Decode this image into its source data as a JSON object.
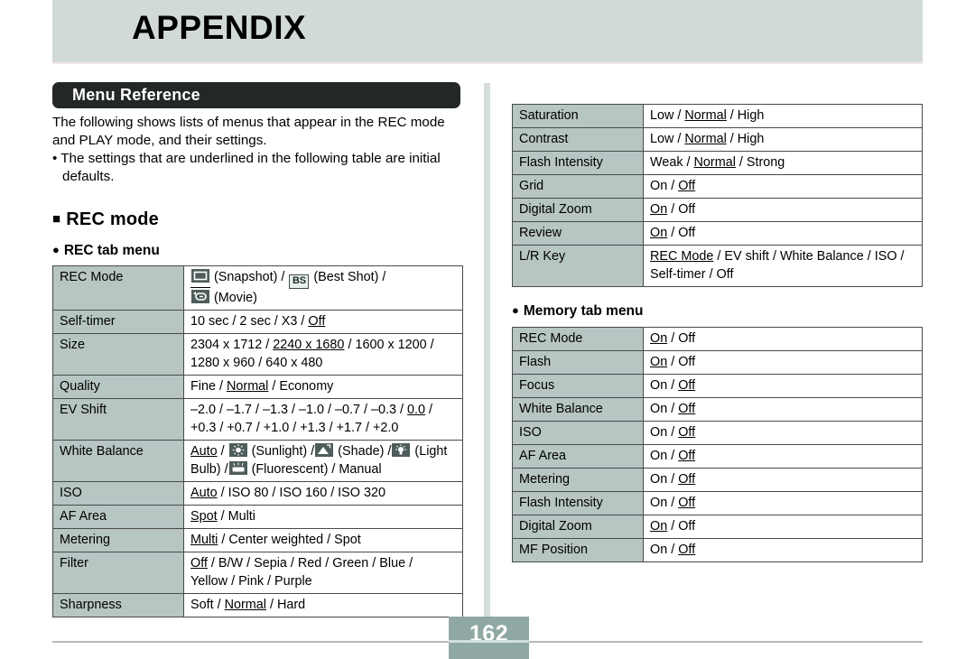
{
  "header": {
    "title": "APPENDIX"
  },
  "section": {
    "banner_label": "Menu Reference"
  },
  "intro": {
    "paragraph": "The following shows lists of menus that appear in the REC mode and PLAY mode, and their settings.",
    "bullet_glyph": "•",
    "bullet": "The settings that are underlined in the following table are initial defaults."
  },
  "rec_mode": {
    "square_glyph": "■",
    "heading": "REC mode",
    "dot_glyph": "●",
    "rec_tab_heading": "REC tab menu",
    "memory_tab_heading": "Memory tab menu"
  },
  "rec_tab_rows": [
    {
      "label": "REC Mode",
      "icon_snapshot": "snapshot-icon",
      "text_snapshot": "(Snapshot) /",
      "icon_bs_label": "BS",
      "text_bs": "(Best Shot) /",
      "icon_movie": "movie-icon",
      "text_movie": "(Movie)"
    },
    {
      "label": "Self-timer",
      "parts": [
        "10 sec / 2 sec / X3 / ",
        "Off"
      ]
    },
    {
      "label": "Size",
      "line1_a": "2304 x 1712 / ",
      "line1_u": "2240 x 1680",
      "line1_b": " / 1600 x 1200 /",
      "line2": "1280 x 960 / 640 x 480"
    },
    {
      "label": "Quality",
      "a": "Fine / ",
      "u": "Normal",
      "b": " / Economy"
    },
    {
      "label": "EV Shift",
      "line1_a": "–2.0 / –1.7 / –1.3 / –1.0 / –0.7 / –0.3 / ",
      "line1_u": "0.0",
      "line1_b": " /",
      "line2": "+0.3 / +0.7 / +1.0 / +1.3 / +1.7 / +2.0"
    },
    {
      "label": "White Balance",
      "wb_auto": "Auto",
      "wb_sep1": " / ",
      "icon_sunlight": "sunlight-icon",
      "wb_sunlight": "(Sunlight) /",
      "icon_shade": "shade-icon",
      "wb_shade": "(Shade) /",
      "icon_bulb": "light-bulb-icon",
      "wb_bulb": "(Light Bulb) /",
      "icon_fluorescent": "fluorescent-icon",
      "wb_fluorescent": "(Fluorescent) / Manual"
    },
    {
      "label": "ISO",
      "a": "",
      "u": "Auto",
      "b": "  / ISO 80 / ISO 160 / ISO 320"
    },
    {
      "label": "AF Area",
      "a": "",
      "u": "Spot",
      "b": " / Multi"
    },
    {
      "label": "Metering",
      "a": "",
      "u": "Multi",
      "b": " / Center weighted / Spot"
    },
    {
      "label": "Filter",
      "line1_u": "Off",
      "line1_b": " / B/W / Sepia / Red / Green / Blue /",
      "line2": "Yellow / Pink / Purple"
    },
    {
      "label": "Sharpness",
      "a": "Soft / ",
      "u": "Normal",
      "b": " / Hard"
    }
  ],
  "rec_tab_rows_right": [
    {
      "label": "Saturation",
      "a": "Low / ",
      "u": "Normal",
      "b": " / High"
    },
    {
      "label": "Contrast",
      "a": "Low / ",
      "u": "Normal",
      "b": " / High"
    },
    {
      "label": "Flash Intensity",
      "a": "Weak / ",
      "u": "Normal",
      "b": " / Strong"
    },
    {
      "label": "Grid",
      "a": "On / ",
      "u": "Off",
      "b": ""
    },
    {
      "label": "Digital Zoom",
      "a": "",
      "u": "On",
      "b": " / Off"
    },
    {
      "label": "Review",
      "a": "",
      "u": "On",
      "b": " / Off"
    },
    {
      "label": "L/R Key",
      "line1_u": "REC Mode",
      "line1_b": " / EV shift / White Balance / ISO /",
      "line2": "Self-timer / Off"
    }
  ],
  "memory_tab_rows": [
    {
      "label": "REC Mode",
      "a": "",
      "u": "On",
      "b": " / Off"
    },
    {
      "label": "Flash",
      "a": "",
      "u": "On",
      "b": " / Off"
    },
    {
      "label": "Focus",
      "a": "On / ",
      "u": "Off",
      "b": ""
    },
    {
      "label": "White Balance",
      "a": "On / ",
      "u": "Off",
      "b": ""
    },
    {
      "label": "ISO",
      "a": "On / ",
      "u": "Off",
      "b": ""
    },
    {
      "label": "AF Area",
      "a": "On / ",
      "u": "Off",
      "b": ""
    },
    {
      "label": "Metering",
      "a": "On / ",
      "u": "Off",
      "b": ""
    },
    {
      "label": "Flash Intensity",
      "a": "On / ",
      "u": "Off",
      "b": ""
    },
    {
      "label": "Digital Zoom",
      "a": "",
      "u": "On",
      "b": " / Off"
    },
    {
      "label": "MF Position",
      "a": "On / ",
      "u": "Off",
      "b": ""
    }
  ],
  "footer": {
    "page_number": "162"
  },
  "colors": {
    "header_bg": "#d2dad8",
    "banner_bg": "#232728",
    "label_cell_bg": "#b7c5c3",
    "icon_bg": "#4e5d5b",
    "page_box_bg": "#90a8a3"
  }
}
